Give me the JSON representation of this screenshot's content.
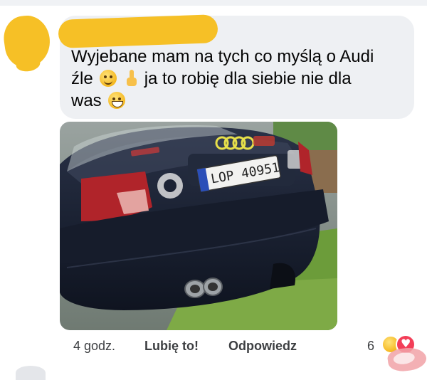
{
  "comment": {
    "line1": "Wyjebane mam na tych co myślą o Audi",
    "line2a": "źle",
    "line2b": "ja to robię dla siebie nie dla",
    "line3": "was",
    "emoji_names": [
      "smiling-face-icon",
      "pointing-finger-icon",
      "grinning-face-icon"
    ]
  },
  "photo": {
    "subject": "car-rear-photo",
    "plate": "LOP 40951",
    "colors": {
      "car": "#1b2233",
      "grass": "#6c9c3a",
      "taillight": "#b0242a",
      "badge": "#e8e04a"
    }
  },
  "actions": {
    "time": "4 godz.",
    "like": "Lubię to!",
    "reply": "Odpowiedz"
  },
  "reactions": {
    "count": "6",
    "types": [
      "haha-icon",
      "love-icon"
    ]
  },
  "theme": {
    "bubble": "#eef0f3",
    "redaction": "#f6c026",
    "meta_text": "#3d3f42"
  }
}
